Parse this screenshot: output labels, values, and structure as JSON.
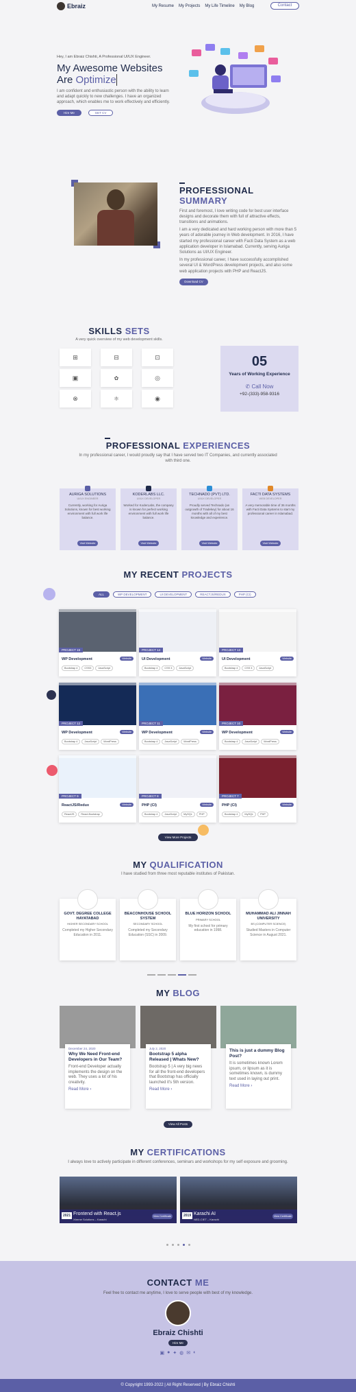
{
  "nav": {
    "brand": "Ebraiz",
    "items": [
      "My Resume",
      "My Projects",
      "My Life Timeline",
      "My Blog"
    ],
    "contact": "Contact"
  },
  "hero": {
    "intro": "Hey, I am Ebraiz Chishti, A Professional UI/UX Engineer.",
    "title1": "My Awesome Websites",
    "title2": "Are",
    "title2_acc": "Optimize",
    "para": "I am confident and enthusiastic person with the ability to learn and adapt quickly to new challenges. I have an organized approach, which enables me to work effectively and efficiently.",
    "btn1": "Hire Me",
    "btn2": "GET CV"
  },
  "summary": {
    "title": "PROFESSIONAL",
    "title_acc": "SUMMARY",
    "p1": "First and foremost, I love writing code for best user interface designs and decorate them with full of attractive effects, transitions and animations.",
    "p2": "I am a very dedicated and hard working person with more than 5 years of adorable journey in Web development. In 2016, I have started my professional career with Facti Data System as a web application developer in Islamabad. Currently, serving Auriga Solutions as UI/UX Engineer.",
    "p3": "In my professional career, I have successfully accomplished several UI & WordPress development projects, and also some web application projects with PHP and ReactJS.",
    "btn": "Download CV"
  },
  "skills": {
    "title": "SKILLS",
    "title_acc": "SETS",
    "sub": "A very quick overview of my web development skills.",
    "years": "05",
    "years_label": "Years of Working Experience",
    "call": "Call Now",
    "phone": "+92-(333)-958-9316"
  },
  "experience": {
    "title": "PROFESSIONAL",
    "title_acc": "EXPERIENCES",
    "sub": "In my professional career, I would proudly say that I have served two IT Companies, and currently associated with third one.",
    "cards": [
      {
        "name": "AURIGA SOLUTIONS",
        "role": "UI/UX ENGINEER",
        "desc": "Currently, working for Auriga Solutions, known for best working environment with full work life balance.",
        "btn": "Visit Website",
        "color": "#5b5fa6"
      },
      {
        "name": "KODERLABS LLC.",
        "role": "UI/UX DEVELOPER",
        "desc": "Worked for KoderLabs, the company is known for perfect working environment with full work life balance.",
        "btn": "Visit Website",
        "color": "#1f2a4a"
      },
      {
        "name": "TECHNADO (PVT) LTD.",
        "role": "UI/UX DEVELOPER",
        "desc": "Proudly served Technado (an outgrowth of Tradekey) for about 16 months with all of my best knowledge and experience.",
        "btn": "Visit Website",
        "color": "#2d8fd5"
      },
      {
        "name": "FACTI DATA SYSTEMS",
        "role": "WEB DEVELOPER",
        "desc": "A very memorable time of 36 months with Facti Data Systems to start my professional career in Islamabad.",
        "btn": "Visit Website",
        "color": "#e0892a"
      }
    ]
  },
  "projects": {
    "title": "MY RECENT",
    "title_acc": "PROJECTS",
    "filters": [
      "ALL",
      "WP DEVELOPMENT",
      "UI DEVELOPMENT",
      "REACTJS/REDUX",
      "PHP (CI)"
    ],
    "btn": "View More Projects",
    "items": [
      {
        "num": "PROJECT 15",
        "type": "WP Development",
        "tags": [
          "Bootstrap 4",
          "CSS3",
          "JavaScript"
        ],
        "shot": "#5a6270"
      },
      {
        "num": "PROJECT 14",
        "type": "UI Development",
        "tags": [
          "Bootstrap 4",
          "CSS 3",
          "JavaScript"
        ],
        "shot": "#eef0f5"
      },
      {
        "num": "PROJECT 13",
        "type": "UI Development",
        "tags": [
          "Bootstrap 4",
          "CSS 3",
          "JavaScript"
        ],
        "shot": "#f4f4f4"
      },
      {
        "num": "PROJECT 12",
        "type": "WP Development",
        "tags": [
          "Bootstrap 4",
          "JavaScript",
          "WordPress"
        ],
        "shot": "#142a56"
      },
      {
        "num": "PROJECT 11",
        "type": "WP Development",
        "tags": [
          "Bootstrap 4",
          "JavaScript",
          "WordPress"
        ],
        "shot": "#3a6fb6"
      },
      {
        "num": "PROJECT 10",
        "type": "WP Development",
        "tags": [
          "Bootstrap 4",
          "JavaScript",
          "WordPress"
        ],
        "shot": "#7a2040"
      },
      {
        "num": "PROJECT 9",
        "type": "ReactJS/Redux",
        "tags": [
          "ReactJS",
          "React-Bootstrap"
        ],
        "shot": "#eaf2fb"
      },
      {
        "num": "PROJECT 8",
        "type": "PHP (CI)",
        "tags": [
          "Bootstrap 4",
          "JavaScript",
          "MySQL",
          "PHP"
        ],
        "shot": "#f0f1f7"
      },
      {
        "num": "PROJECT 7",
        "type": "PHP (CI)",
        "tags": [
          "Bootstrap 4",
          "MySQL",
          "PHP"
        ],
        "shot": "#7a1f2e"
      }
    ]
  },
  "qualification": {
    "title": "MY",
    "title_acc": "QUALIFICATION",
    "sub": "I have studied from three most reputable institutes of Pakistan.",
    "items": [
      {
        "name": "GOVT. DEGREE COLLEGE HAYATABAD",
        "level": "HIGHER SECONDARY SCHOOL",
        "desc": "Completed my Higher Secondary Education in 2011."
      },
      {
        "name": "BEACONHOUSE SCHOOL SYSTEM",
        "level": "SECONDARY SCHOOL",
        "desc": "Completed my Secondary Education (SSC) in 2009."
      },
      {
        "name": "BLUE HORIZON SCHOOL",
        "level": "PRIMARY SCHOOL",
        "desc": "My first school for primary education in 1998."
      },
      {
        "name": "MUHAMMAD ALI JINNAH UNIVERSITY",
        "level": "BS (COMPUTER SCIENCE)",
        "desc": "Studied Masters in Computer Science in August 2021."
      }
    ]
  },
  "blog": {
    "title": "MY",
    "title_acc": "BLOG",
    "btn": "View All Posts",
    "posts": [
      {
        "date": "December 24, 2020",
        "title": "Why We Need Front-end Developers in Our Team?",
        "desc": "Front-end Developer actually implements the design on the web. They uses a lot of his creativity.",
        "more": "Read More ›"
      },
      {
        "date": "July 2, 2020",
        "title": "Bootstrap 5 alpha Released | Whats New?",
        "desc": "Bootstrap 5 | A very big news for all the front-end developers that Bootstrap has officially launched it's 5th version.",
        "more": "Read More ›"
      },
      {
        "date": "",
        "title": "This is just a dummy Blog Post?",
        "desc": "It is sometimes known Lorem ipsum, or lipsum as it is sometimes known, is dummy text used in laying out print.",
        "more": "Read More ›"
      }
    ]
  },
  "certs": {
    "title": "MY",
    "title_acc": "CERTIFICATIONS",
    "sub": "I always love to actively participate in different conferences, seminars and workshops for my self exposure and grooming.",
    "items": [
      {
        "year": "2021",
        "title": "Frontend with React.js",
        "org": "Xtreme Solutions – Karachi",
        "btn": "View Certificate"
      },
      {
        "year": "2019",
        "title": "Karachi AI",
        "org": "NED-CIET – Karachi",
        "btn": "View Certificate"
      }
    ]
  },
  "contact": {
    "title": "CONTACT",
    "title_acc": "ME",
    "sub": "Feel free to contact me anytime, I love to serve people with best of my knowledge.",
    "name": "Ebraiz Chishti",
    "btn": "Hire Me"
  },
  "footer": {
    "text": "© Copyright 1993-2022 | All Right Reserved | By Ebraiz Chishti"
  }
}
